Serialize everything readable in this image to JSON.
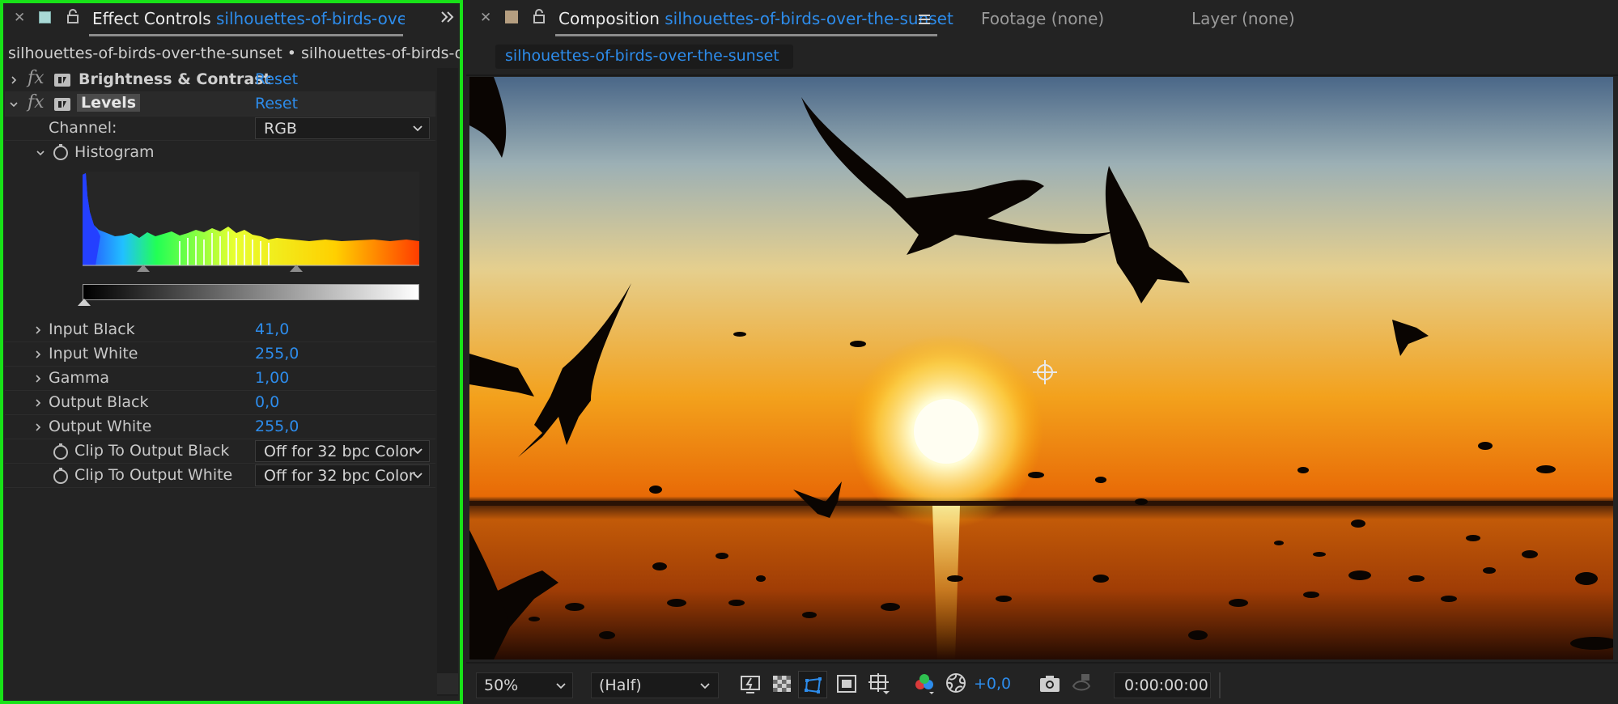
{
  "effect_controls": {
    "tab_title": "Effect Controls",
    "tab_subject": "silhouettes-of-birds-over-the-",
    "breadcrumb": "silhouettes-of-birds-over-the-sunset • silhouettes-of-birds-over-t",
    "effects": [
      {
        "name": "Brightness & Contrast",
        "reset": "Reset"
      },
      {
        "name": "Levels",
        "reset": "Reset"
      }
    ],
    "channel_label": "Channel:",
    "channel_value": "RGB",
    "histogram_label": "Histogram",
    "properties": [
      {
        "label": "Input Black",
        "value": "41,0"
      },
      {
        "label": "Input White",
        "value": "255,0"
      },
      {
        "label": "Gamma",
        "value": "1,00"
      },
      {
        "label": "Output Black",
        "value": "0,0"
      },
      {
        "label": "Output White",
        "value": "255,0"
      }
    ],
    "clip_black_label": "Clip To Output Black",
    "clip_black_value": "Off for 32 bpc Color",
    "clip_white_label": "Clip To Output White",
    "clip_white_value": "Off for 32 bpc Color"
  },
  "composition": {
    "tab_title": "Composition",
    "tab_subject": "silhouettes-of-birds-over-the-sunset",
    "footage_tab": "Footage (none)",
    "layer_tab": "Layer (none)",
    "comp_chip": "silhouettes-of-birds-over-the-sunset"
  },
  "viewer_toolbar": {
    "zoom": "50%",
    "resolution": "(Half)",
    "exposure": "+0,0",
    "timecode": "0:00:00:00"
  },
  "icons": [
    "close-icon",
    "effect-color-swatch-icon",
    "lock-icon",
    "overflow-chevrons-icon",
    "fx-icon",
    "layer-icon",
    "stopwatch-icon",
    "panel-menu-icon",
    "region-of-interest-icon",
    "transparency-grid-icon",
    "mask-path-icon",
    "safe-margins-icon",
    "grid-icon",
    "channel-icon",
    "exposure-reset-icon",
    "snapshot-icon",
    "show-snapshot-icon"
  ],
  "colors": {
    "accent_blue": "#2d8ceb",
    "highlight_green": "#18e218",
    "panel_bg": "#232323"
  }
}
